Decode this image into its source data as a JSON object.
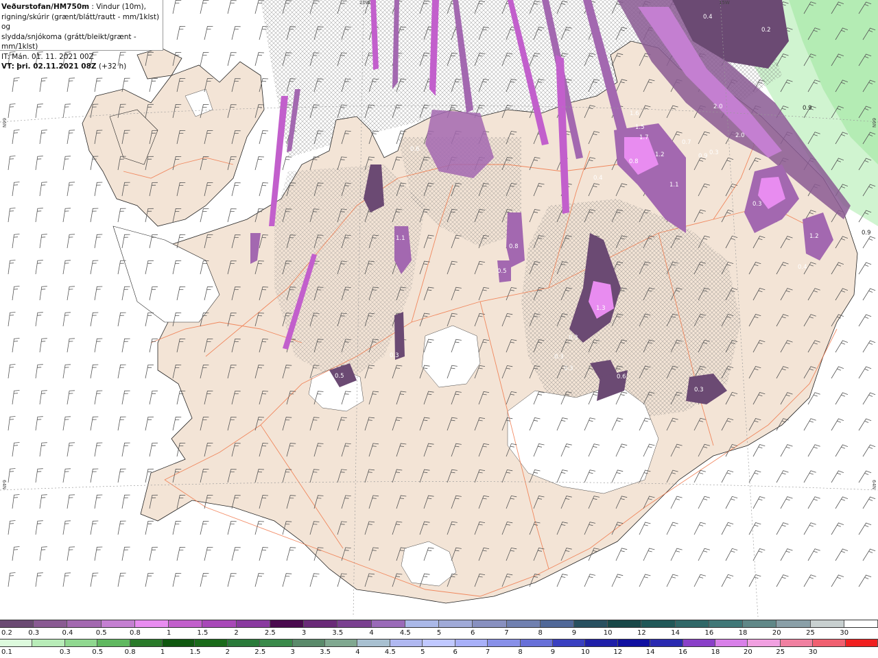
{
  "info": {
    "title": "Veðurstofan/HM750m",
    "desc1": " : Vindur (10m),",
    "desc2": "rigning/skúrir (grænt/blátt/rautt - mm/1klst) og",
    "desc3": "slydda/snjókoma (grátt/bleikt/grænt - mm/1klst)",
    "it_line": "IT: Mán. 01. 11. 2021 00Z",
    "vt_prefix": "VT:",
    "vt_time": "þri. 02.11.2021 08Z",
    "vt_offset": "(+32 h)"
  },
  "map_labels": {
    "lon_20w": "20W",
    "lon_15w": "15W",
    "lat_66n_left": "66N",
    "lat_66n_right": "66N",
    "lat_64n_left": "64N",
    "lat_64n_right": "64N"
  },
  "precip_values": [
    "0.4",
    "0.2",
    "1.6",
    "1.5",
    "1.7",
    "2.0",
    "2.0",
    "0.8",
    "1.2",
    "0.3",
    "0.7",
    "1.1",
    "0.9",
    "0.6",
    "0.4",
    "0.3",
    "1.1",
    "1.3",
    "0.3",
    "0.3",
    "1.2",
    "0.5",
    "0.5",
    "0.8",
    "0.3",
    "0.3",
    "0.3",
    "0.4",
    "0.6",
    "0.9",
    "0.9"
  ],
  "legend_snow": {
    "colors": [
      "#6b4a73",
      "#8a5a93",
      "#a368b0",
      "#c47fd1",
      "#e88cf0",
      "#c25fcc",
      "#a848b8",
      "#8a3aa0",
      "#4a0a4e",
      "#6a2a78",
      "#7a4090",
      "#9a6ab8",
      "#aab8e8",
      "#a0aad8",
      "#8890c0",
      "#7080b0",
      "#506898",
      "#285060",
      "#184848",
      "#205858",
      "#306868",
      "#407878",
      "#608888",
      "#8aa0a8",
      "#c8d0d0",
      "#ffffff"
    ],
    "labels": [
      "0.2",
      "0.3",
      "0.4",
      "0.5",
      "0.8",
      "1",
      "1.5",
      "2",
      "2.5",
      "3",
      "3.5",
      "4",
      "4.5",
      "5",
      "6",
      "7",
      "8",
      "9",
      "10",
      "12",
      "14",
      "16",
      "18",
      "20",
      "25",
      "30"
    ]
  },
  "legend_rain": {
    "colors": [
      "#ddfadd",
      "#b8ecb8",
      "#90d890",
      "#60b860",
      "#2a7a2a",
      "#105810",
      "#1a6a1a",
      "#2a7a3a",
      "#3a8a4a",
      "#5a8a6a",
      "#80a890",
      "#a8c0d0",
      "#b0b8f0",
      "#c0c8ff",
      "#a8b0f8",
      "#8890e8",
      "#6870d8",
      "#3a40c0",
      "#2020a8",
      "#1010a0",
      "#2a2ab0",
      "#8a40c8",
      "#d880e8",
      "#f0a0e0",
      "#f080a0",
      "#f06070",
      "#f02020"
    ],
    "labels": [
      "0.1",
      "0.3",
      "0.5",
      "0.8",
      "1",
      "1.5",
      "2",
      "2.5",
      "3",
      "3.5",
      "4",
      "4.5",
      "5",
      "6",
      "7",
      "8",
      "9",
      "10",
      "12",
      "14",
      "16",
      "18",
      "20",
      "25",
      "30"
    ]
  },
  "colors": {
    "land": "#f3e4d6",
    "coast": "#222222",
    "roads": "#f07040",
    "snow_dark": "#6b4a73",
    "snow_mid": "#a368b0",
    "snow_light": "#e88cf0",
    "rain_light": "#c8f2c8",
    "glacier": "#ffffff",
    "wind_barb": "#555555"
  }
}
